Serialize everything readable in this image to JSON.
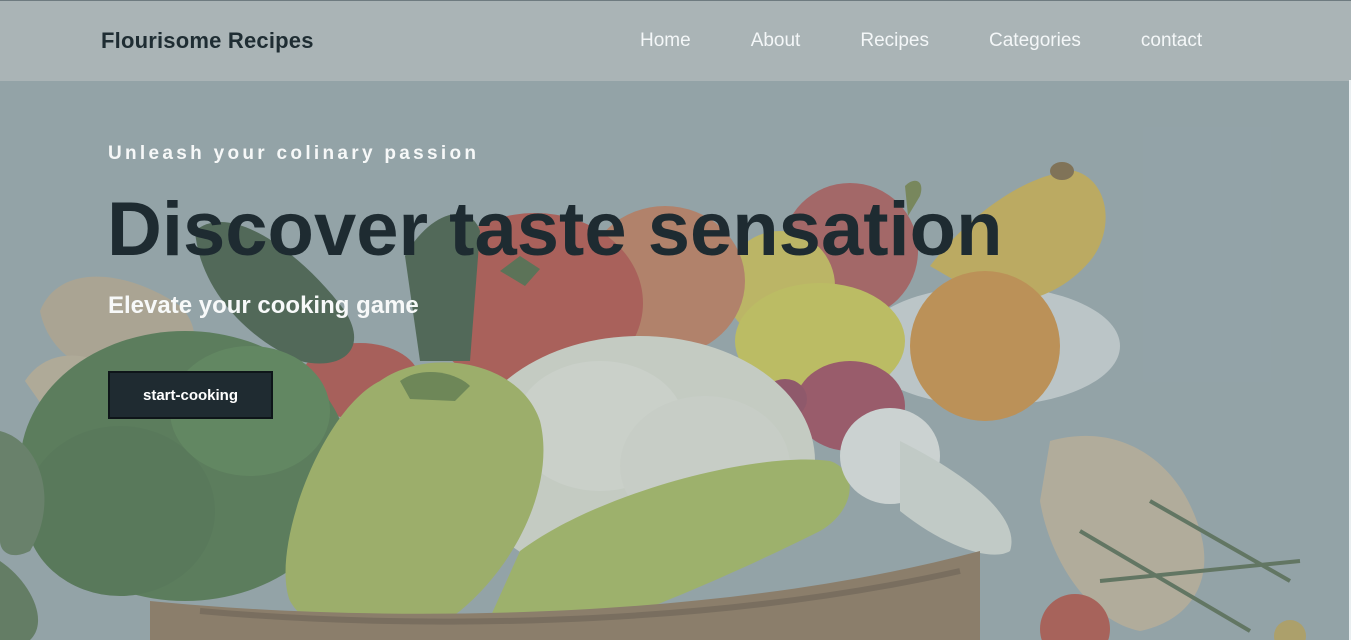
{
  "header": {
    "brand": "Flourisome Recipes",
    "nav": [
      {
        "label": "Home"
      },
      {
        "label": "About"
      },
      {
        "label": "Recipes"
      },
      {
        "label": "Categories"
      },
      {
        "label": "contact"
      }
    ]
  },
  "hero": {
    "tagline": "Unleash your colinary passion",
    "headline": "Discover taste sensation",
    "subhead": "Elevate your cooking game",
    "cta_label": "start-cooking",
    "background_image": "vegetable-and-fruit-basket"
  },
  "colors": {
    "navbar_bg": "#aab4b6",
    "hero_tint": "#98a6aa",
    "headline": "#1e2b31",
    "button_bg": "#1f2b31",
    "light_text": "#f6f8f8"
  }
}
